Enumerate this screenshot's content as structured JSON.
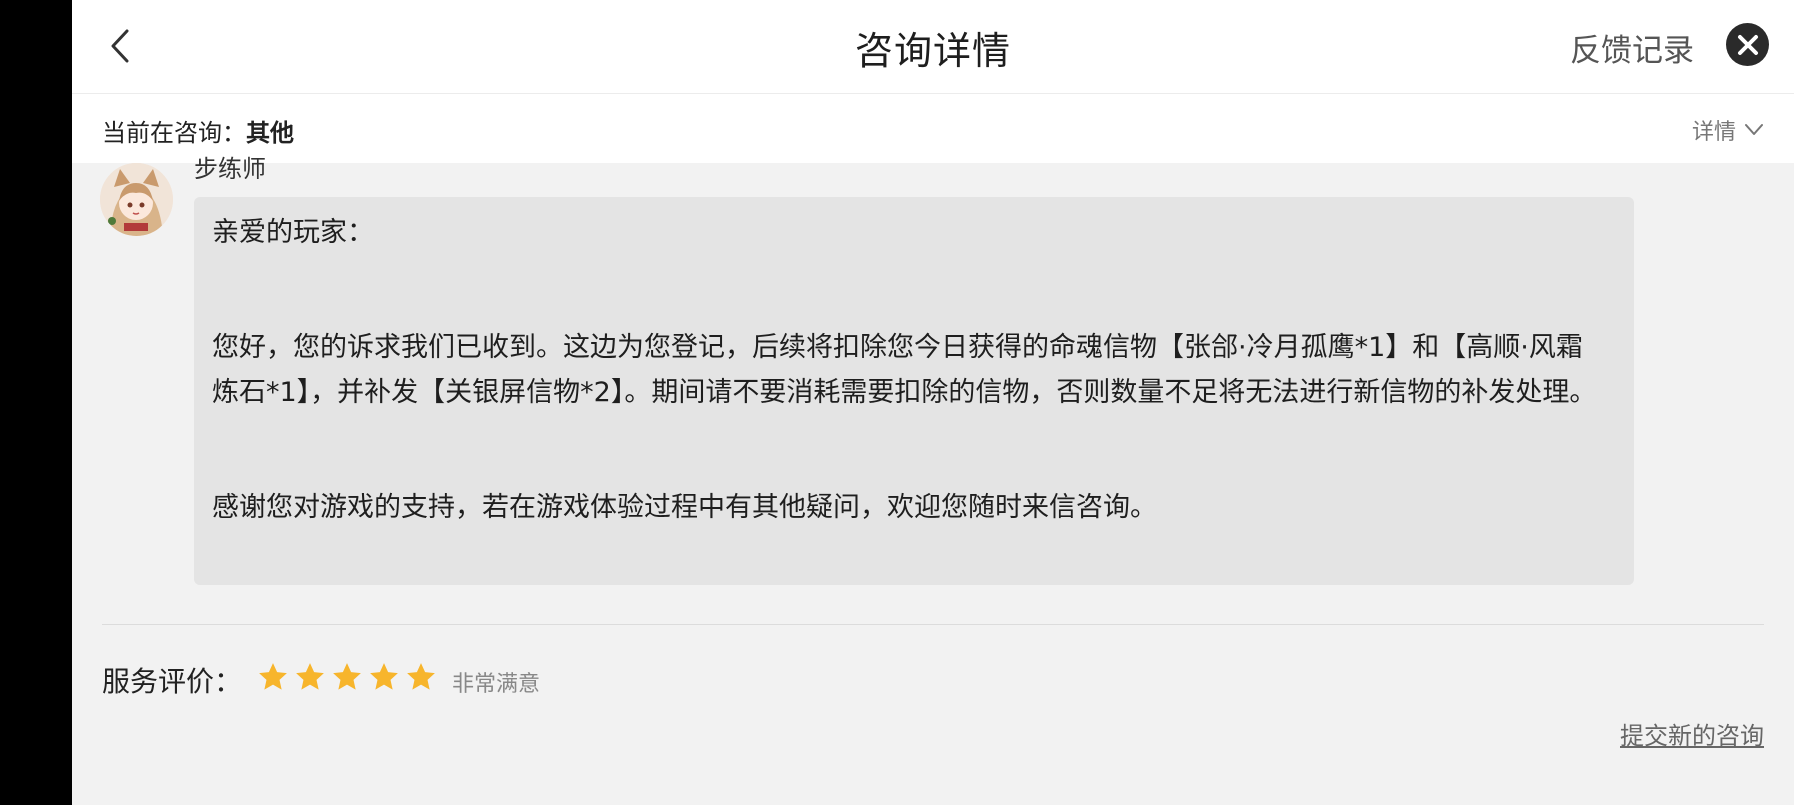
{
  "header": {
    "title": "咨询详情",
    "history_label": "反馈记录",
    "back_icon": "chevron-left-icon",
    "close_icon": "close-icon"
  },
  "topic": {
    "label": "当前在咨询：",
    "value": "其他",
    "detail_label": "详情",
    "detail_icon": "chevron-down-icon"
  },
  "message": {
    "sender": "步练师",
    "greeting": "亲爱的玩家：",
    "body_1": "您好，您的诉求我们已收到。这边为您登记，后续将扣除您今日获得的命魂信物【张郃·冷月孤鹰*1】和【高顺·风霜炼石*1】，并补发【关银屏信物*2】。期间请不要消耗需要扣除的信物，否则数量不足将无法进行新信物的补发处理。",
    "body_2": "感谢您对游戏的支持，若在游戏体验过程中有其他疑问，欢迎您随时来信咨询。"
  },
  "rating": {
    "label": "服务评价：",
    "stars": 5,
    "max_stars": 5,
    "text": "非常满意",
    "star_color": "#f7b52c"
  },
  "footer": {
    "new_consult_label": "提交新的咨询"
  }
}
